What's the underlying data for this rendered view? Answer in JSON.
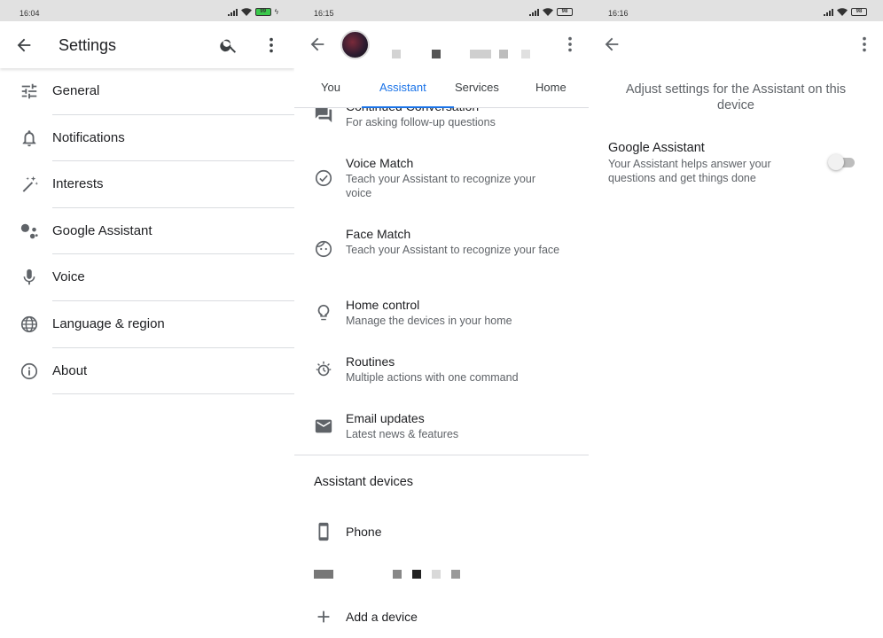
{
  "screens": [
    {
      "status": {
        "time": "16:04",
        "battery": "99"
      },
      "title": "Settings",
      "items": [
        {
          "label": "General",
          "icon": "tune-icon"
        },
        {
          "label": "Notifications",
          "icon": "bell-icon"
        },
        {
          "label": "Interests",
          "icon": "magic-wand-icon"
        },
        {
          "label": "Google Assistant",
          "icon": "assistant-icon"
        },
        {
          "label": "Voice",
          "icon": "microphone-icon"
        },
        {
          "label": "Language & region",
          "icon": "globe-icon"
        },
        {
          "label": "About",
          "icon": "info-icon"
        }
      ]
    },
    {
      "status": {
        "time": "16:15",
        "battery": "98"
      },
      "tabs": [
        "You",
        "Assistant",
        "Services",
        "Home"
      ],
      "active_tab": "Assistant",
      "items": [
        {
          "title": "Continued Conversation",
          "subtitle": "For asking follow-up questions",
          "icon": "chat-icon"
        },
        {
          "title": "Voice Match",
          "subtitle": "Teach your Assistant to recognize your voice",
          "icon": "voice-match-icon"
        },
        {
          "title": "Face Match",
          "subtitle": "Teach your Assistant to recognize your face",
          "icon": "face-icon"
        },
        {
          "title": "Home control",
          "subtitle": "Manage the devices in your home",
          "icon": "lightbulb-icon"
        },
        {
          "title": "Routines",
          "subtitle": "Multiple actions with one command",
          "icon": "routines-icon"
        },
        {
          "title": "Email updates",
          "subtitle": "Latest news & features",
          "icon": "mail-icon"
        }
      ],
      "section_title": "Assistant devices",
      "device_label": "Phone",
      "add_device_label": "Add a device"
    },
    {
      "status": {
        "time": "16:16",
        "battery": "98"
      },
      "description": "Adjust settings for the Assistant on this device",
      "setting_title": "Google Assistant",
      "setting_subtitle": "Your Assistant helps answer your questions and get things done",
      "toggle_on": false
    }
  ],
  "colors": {
    "accent": "#1a73e8",
    "text": "#202124",
    "secondary": "#5f6368",
    "divider": "#dadce0",
    "battery_green": "#3ac84b"
  }
}
